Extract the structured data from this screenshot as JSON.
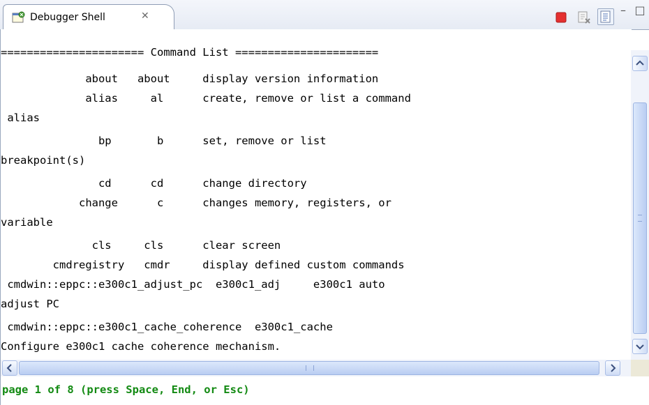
{
  "tab": {
    "title": "Debugger Shell",
    "close_glyph": "✕",
    "icon": "debugger-shell-icon"
  },
  "toolbar": {
    "terminate_icon": "terminate-icon",
    "clear_icon": "clear-console-icon",
    "scroll_lock_icon": "scroll-lock-icon",
    "minimize_glyph": "–",
    "maximize_glyph": "□"
  },
  "console": {
    "lines": [
      "====================== Command List ======================",
      "             about   about     display version information",
      "             alias     al      create, remove or list a command",
      " alias",
      "               bp       b      set, remove or list",
      "breakpoint(s)",
      "               cd      cd      change directory",
      "            change      c      changes memory, registers, or",
      "variable",
      "              cls     cls      clear screen",
      "        cmdregistry   cmdr     display defined custom commands",
      " cmdwin::eppc::e300c1_adjust_pc  e300c1_adj     e300c1 auto",
      "adjust PC",
      " cmdwin::eppc::e300c1_cache_coherence  e300c1_cache",
      "Configure e300c1 cache coherence mechanism."
    ]
  },
  "pager": {
    "text": "page 1 of 8 (press Space, End, or Esc)"
  },
  "colors": {
    "pager_text": "#138a13",
    "terminate": "#e53030",
    "scrollbar": "#b9cdf2"
  }
}
